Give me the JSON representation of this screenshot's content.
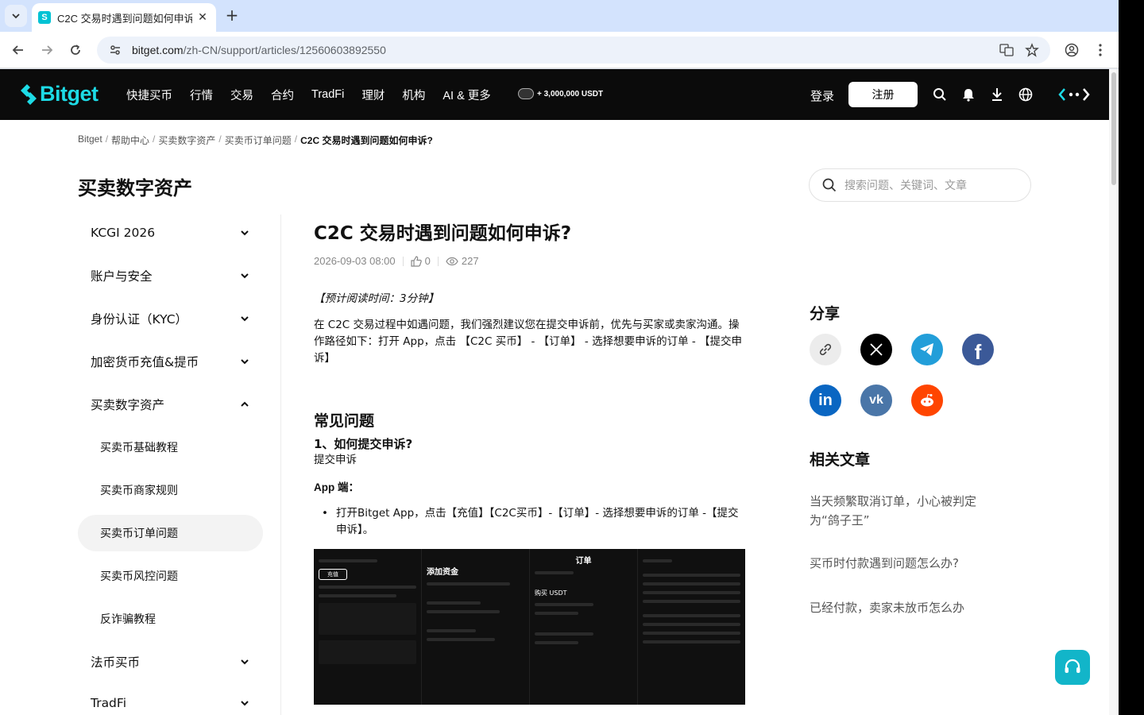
{
  "browser": {
    "tab_title": "C2C 交易时遇到问题如何申诉",
    "url_host": "bitget.com",
    "url_path": "/zh-CN/support/articles/12560603892550"
  },
  "header": {
    "logo": "Bitget",
    "nav": [
      "快捷买币",
      "行情",
      "交易",
      "合约",
      "TradFi",
      "理财",
      "机构",
      "AI & 更多"
    ],
    "promo": "+ 3,000,000 USDT",
    "login": "登录",
    "signup": "注册"
  },
  "breadcrumb": [
    "Bitget",
    "帮助中心",
    "买卖数字资产",
    "买卖币订单问题",
    "C2C 交易时遇到问题如何申诉?"
  ],
  "category_title": "买卖数字资产",
  "search": {
    "placeholder": "搜索问题、关键词、文章"
  },
  "sidebar": {
    "items": [
      "KCGI 2026",
      "账户与安全",
      "身份认证（KYC）",
      "加密货币充值&提币",
      "买卖数字资产",
      "法币买币",
      "TradFi"
    ],
    "subitems": [
      "买卖币基础教程",
      "买卖币商家规则",
      "买卖币订单问题",
      "买卖币风控问题",
      "反诈骗教程"
    ]
  },
  "article": {
    "title": "C2C 交易时遇到问题如何申诉?",
    "date": "2026-09-03 08:00",
    "likes": "0",
    "views": "227",
    "reading_time": "【预计阅读时间：3分钟】",
    "intro": "在 C2C 交易过程中如遇问题，我们强烈建议您在提交申诉前，优先与买家或卖家沟通。操作路径如下：打开 App，点击 【C2C 买币】 - 【订单】 - 选择想要申诉的订单 - 【提交申诉】",
    "faq_heading": "常见问题",
    "q1": "1、如何提交申诉?",
    "q1_sub": "提交申诉",
    "app_label": "App 端：",
    "app_step": "打开Bitget App，点击【充值】【C2C买币】-【订单】- 选择想要申诉的订单 -【提交申诉】。",
    "screenshot": {
      "panel2_title": "添加资金",
      "panel3_title": "订单",
      "panel1_button": "充值",
      "panel3_label": "购买 USDT"
    }
  },
  "right": {
    "share_heading": "分享",
    "related_heading": "相关文章",
    "related": [
      "当天频繁取消订单，小心被判定为“鸽子王”",
      "买币时付款遇到问题怎么办?",
      "已经付款，卖家未放币怎么办"
    ]
  }
}
